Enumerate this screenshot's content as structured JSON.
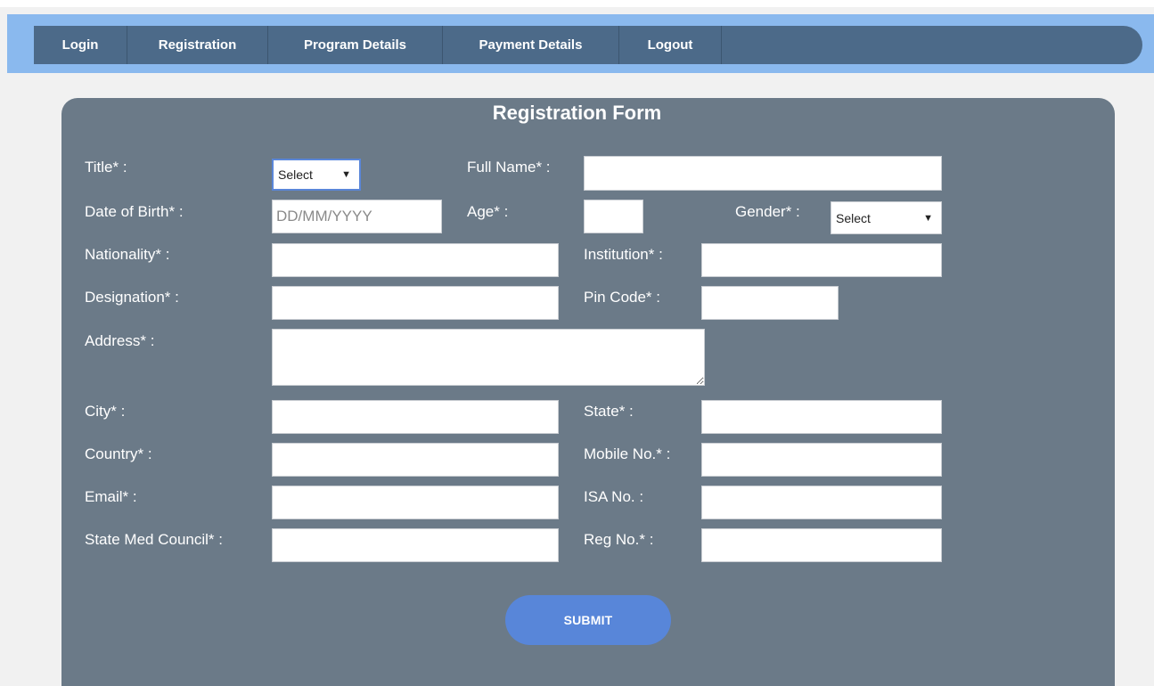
{
  "nav": {
    "items": [
      {
        "label": "Login"
      },
      {
        "label": "Registration"
      },
      {
        "label": "Program Details"
      },
      {
        "label": "Payment Details"
      },
      {
        "label": "Logout"
      }
    ]
  },
  "form": {
    "title": "Registration Form",
    "labels": {
      "title": "Title* :",
      "full_name": "Full Name* :",
      "dob": "Date of Birth* :",
      "age": "Age* :",
      "gender": "Gender* :",
      "nationality": "Nationality* :",
      "institution": "Institution* :",
      "designation": "Designation* :",
      "pin_code": "Pin Code* :",
      "address": "Address* :",
      "city": "City* :",
      "state": "State* :",
      "country": "Country* :",
      "mobile": "Mobile No.* :",
      "email": "Email* :",
      "isa_no": "ISA No. :",
      "state_med_council": "State Med Council* :",
      "reg_no": "Reg No.* :"
    },
    "fields": {
      "title_select": "Select",
      "gender_select": "Select",
      "dob_placeholder": "DD/MM/YYYY",
      "full_name": "",
      "age": "",
      "nationality": "",
      "institution": "",
      "designation": "",
      "pin_code": "",
      "address": "",
      "city": "",
      "state": "",
      "country": "",
      "mobile": "",
      "email": "",
      "isa_no": "",
      "state_med_council": "",
      "reg_no": ""
    },
    "submit_label": "SUBMIT"
  },
  "colors": {
    "nav_band": "#8ab9ee",
    "nav_bar": "#4c6a89",
    "panel": "#6b7a88",
    "submit": "#5886d9"
  }
}
